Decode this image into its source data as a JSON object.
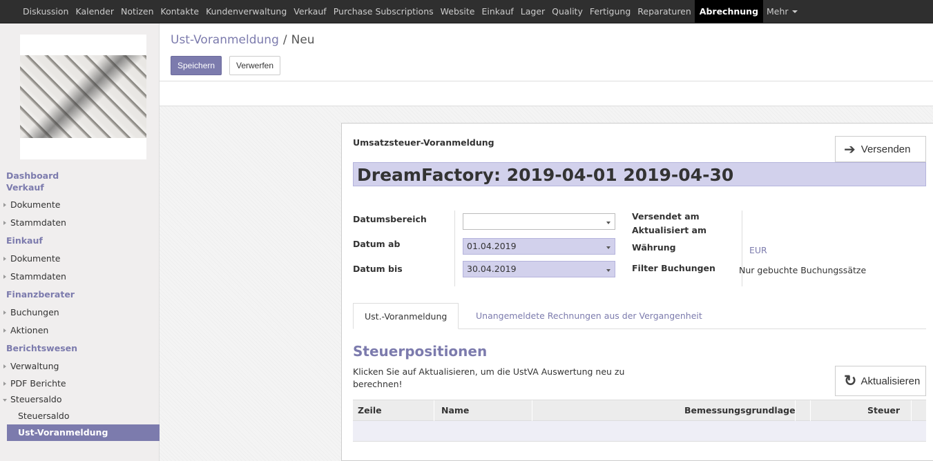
{
  "topnav": {
    "items": [
      "Diskussion",
      "Kalender",
      "Notizen",
      "Kontakte",
      "Kundenverwaltung",
      "Verkauf",
      "Purchase Subscriptions",
      "Website",
      "Einkauf",
      "Lager",
      "Quality",
      "Fertigung",
      "Reparaturen",
      "Abrechnung",
      "Mehr"
    ],
    "active": "Abrechnung"
  },
  "sidebar": {
    "dashboard_section": "Dashboard Verkauf",
    "verkauf_items": [
      "Dokumente",
      "Stammdaten"
    ],
    "einkauf_section": "Einkauf",
    "einkauf_items": [
      "Dokumente",
      "Stammdaten"
    ],
    "finanz_section": "Finanzberater",
    "finanz_items": [
      "Buchungen",
      "Aktionen"
    ],
    "bericht_section": "Berichtswesen",
    "bericht_items": [
      "Verwaltung",
      "PDF Berichte",
      "Steuersaldo"
    ],
    "sub_items": [
      "Steuersaldo",
      "Ust-Voranmeldung"
    ]
  },
  "breadcrumb": {
    "parent": "Ust-Voranmeldung",
    "separator": "/",
    "current": "Neu"
  },
  "buttons": {
    "save": "Speichern",
    "discard": "Verwerfen",
    "send": "Versenden",
    "refresh": "Aktualisieren"
  },
  "form": {
    "label": "Umsatzsteuer-Voranmeldung",
    "title": "DreamFactory: 2019-04-01 2019-04-30",
    "datumsbereich_label": "Datumsbereich",
    "datumsbereich_value": "",
    "datum_ab_label": "Datum ab",
    "datum_ab_value": "01.04.2019",
    "datum_bis_label": "Datum bis",
    "datum_bis_value": "30.04.2019",
    "versendet_label": "Versendet am",
    "aktualisiert_label": "Aktualisiert am",
    "waehrung_label": "Währung",
    "waehrung_value": "EUR",
    "filter_label": "Filter Buchungen",
    "filter_value": "Nur gebuchte Buchungssätze"
  },
  "tabs": [
    "Ust.-Voranmeldung",
    "Unangemeldete Rechnungen aus der Vergangenheit"
  ],
  "section": {
    "title": "Steuerpositionen",
    "hint": "Klicken Sie auf Aktualisieren, um die UstVA Auswertung neu zu berechnen!"
  },
  "table": {
    "columns": [
      "Zeile",
      "Name",
      "Bemessungsgrundlage",
      "Steuer"
    ]
  },
  "colors": {
    "accent": "#7c7bad",
    "highlight": "#d2d1ec",
    "topbar": "#2f2f2f"
  }
}
